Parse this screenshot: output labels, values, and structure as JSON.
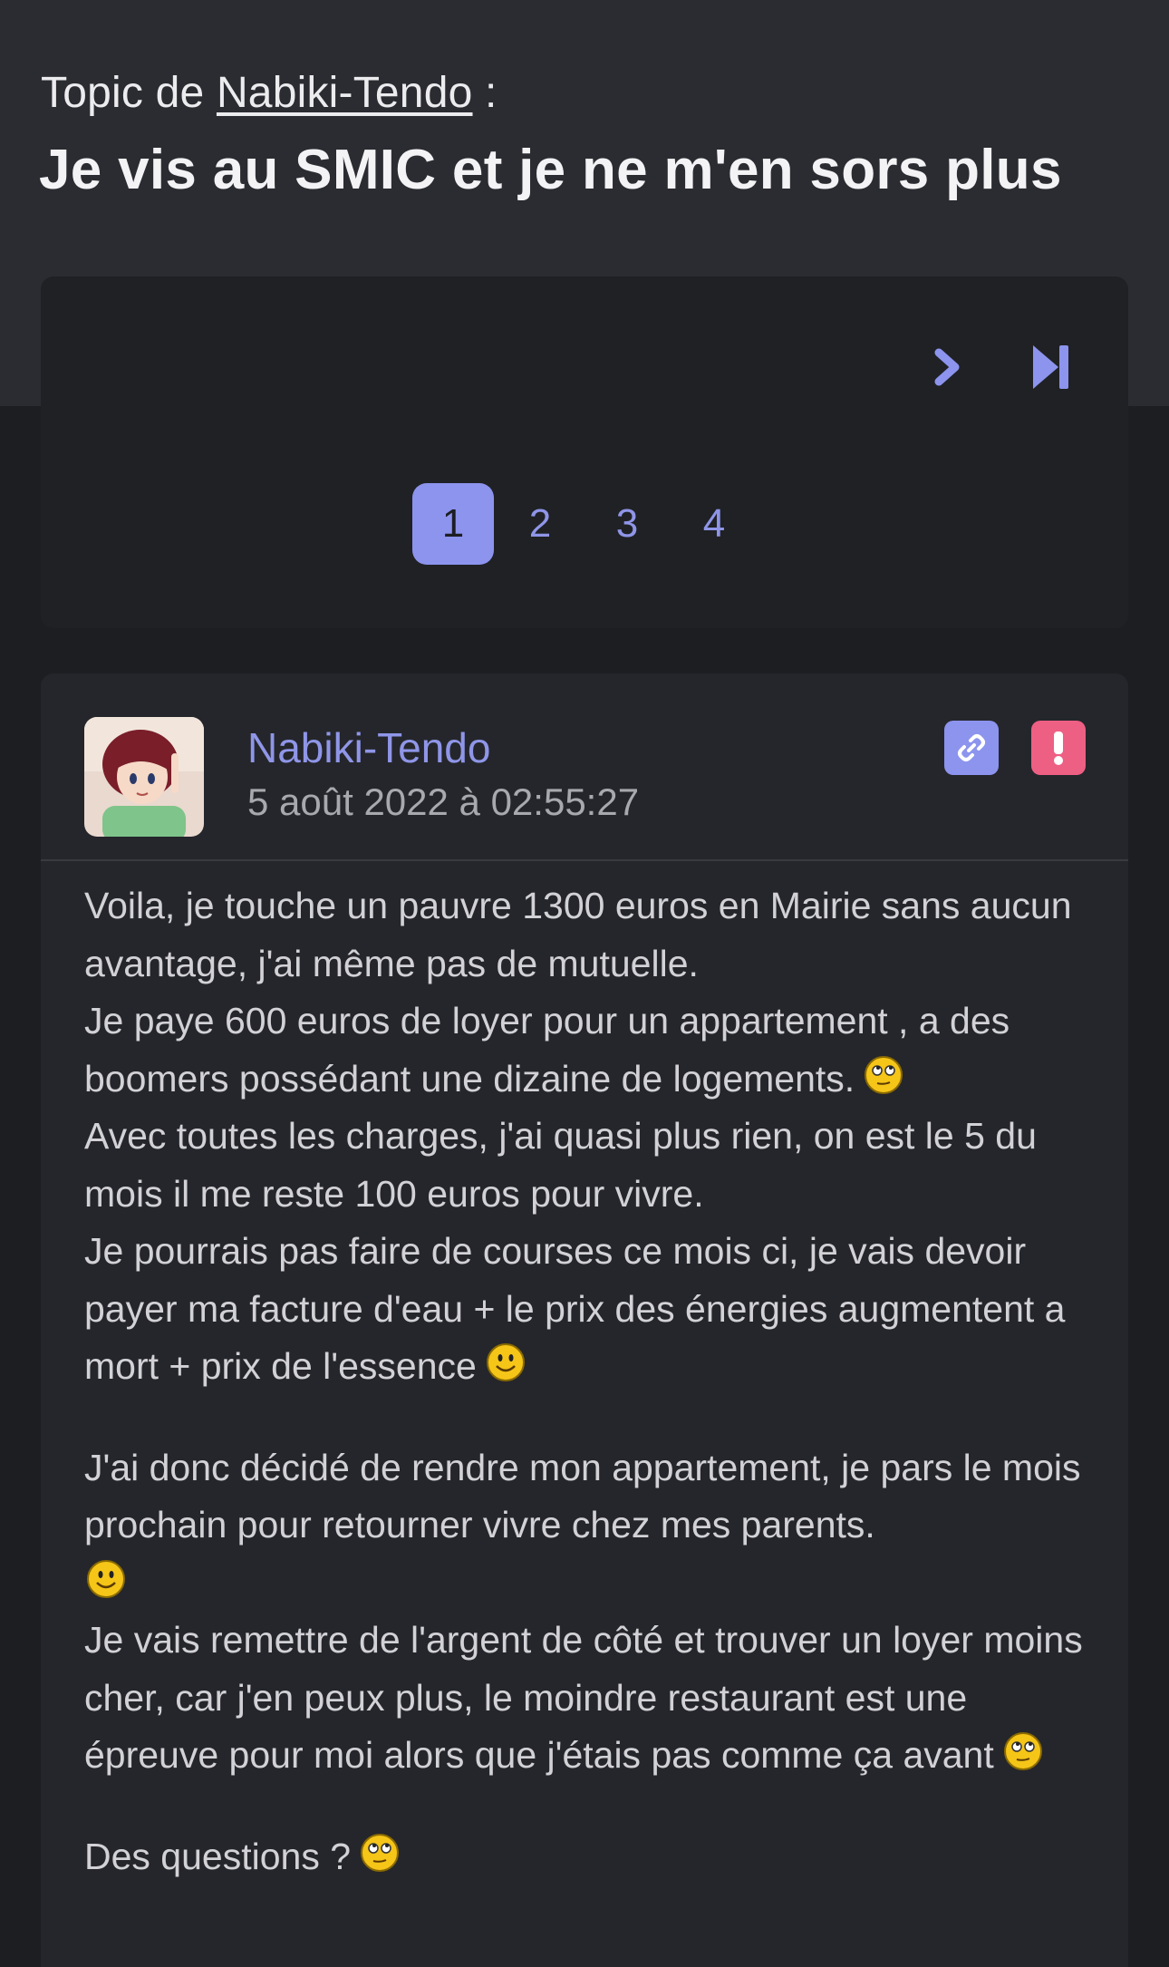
{
  "topic": {
    "prefix": "Topic de",
    "author": "Nabiki-Tendo",
    "suffix": " :",
    "title": "Je vis au SMIC et je ne m'en sors plus"
  },
  "pagination": {
    "pages": [
      "1",
      "2",
      "3",
      "4"
    ],
    "current": "1",
    "next_icon": "chevron-right-icon",
    "last_icon": "skip-to-end-icon"
  },
  "post": {
    "author": "Nabiki-Tendo",
    "date": "5 août 2022 à 02:55:27",
    "actions": {
      "link_icon": "link-icon",
      "report_icon": "exclamation-icon"
    },
    "lines": {
      "l1": "Voila, je touche un pauvre 1300 euros en Mairie sans aucun avantage, j'ai même pas de mutuelle.",
      "l2": "Je paye 600 euros de loyer pour un appartement , a des boomers possédant une dizaine de logements.",
      "l3": "Avec toutes les charges, j'ai quasi plus rien, on est le 5 du mois il me reste 100 euros pour vivre.",
      "l4": "Je pourrais pas faire de courses ce mois ci, je vais devoir payer ma facture d'eau + le prix des énergies augmentent a mort + prix de l'essence",
      "l5": "J'ai donc décidé de rendre mon appartement, je pars le mois prochain pour retourner vivre chez mes parents.",
      "l6": "Je vais remettre de l'argent de côté et trouver un loyer moins cher, car j'en peux plus, le moindre restaurant est une épreuve pour moi alors que j'étais pas comme ça avant",
      "l7": "Des questions ?"
    }
  },
  "colors": {
    "accent": "#8c94ee",
    "danger": "#ee5f84",
    "header_bg": "#2a2c31",
    "page_bg": "#1d1e22",
    "card_bg": "#25262b"
  }
}
